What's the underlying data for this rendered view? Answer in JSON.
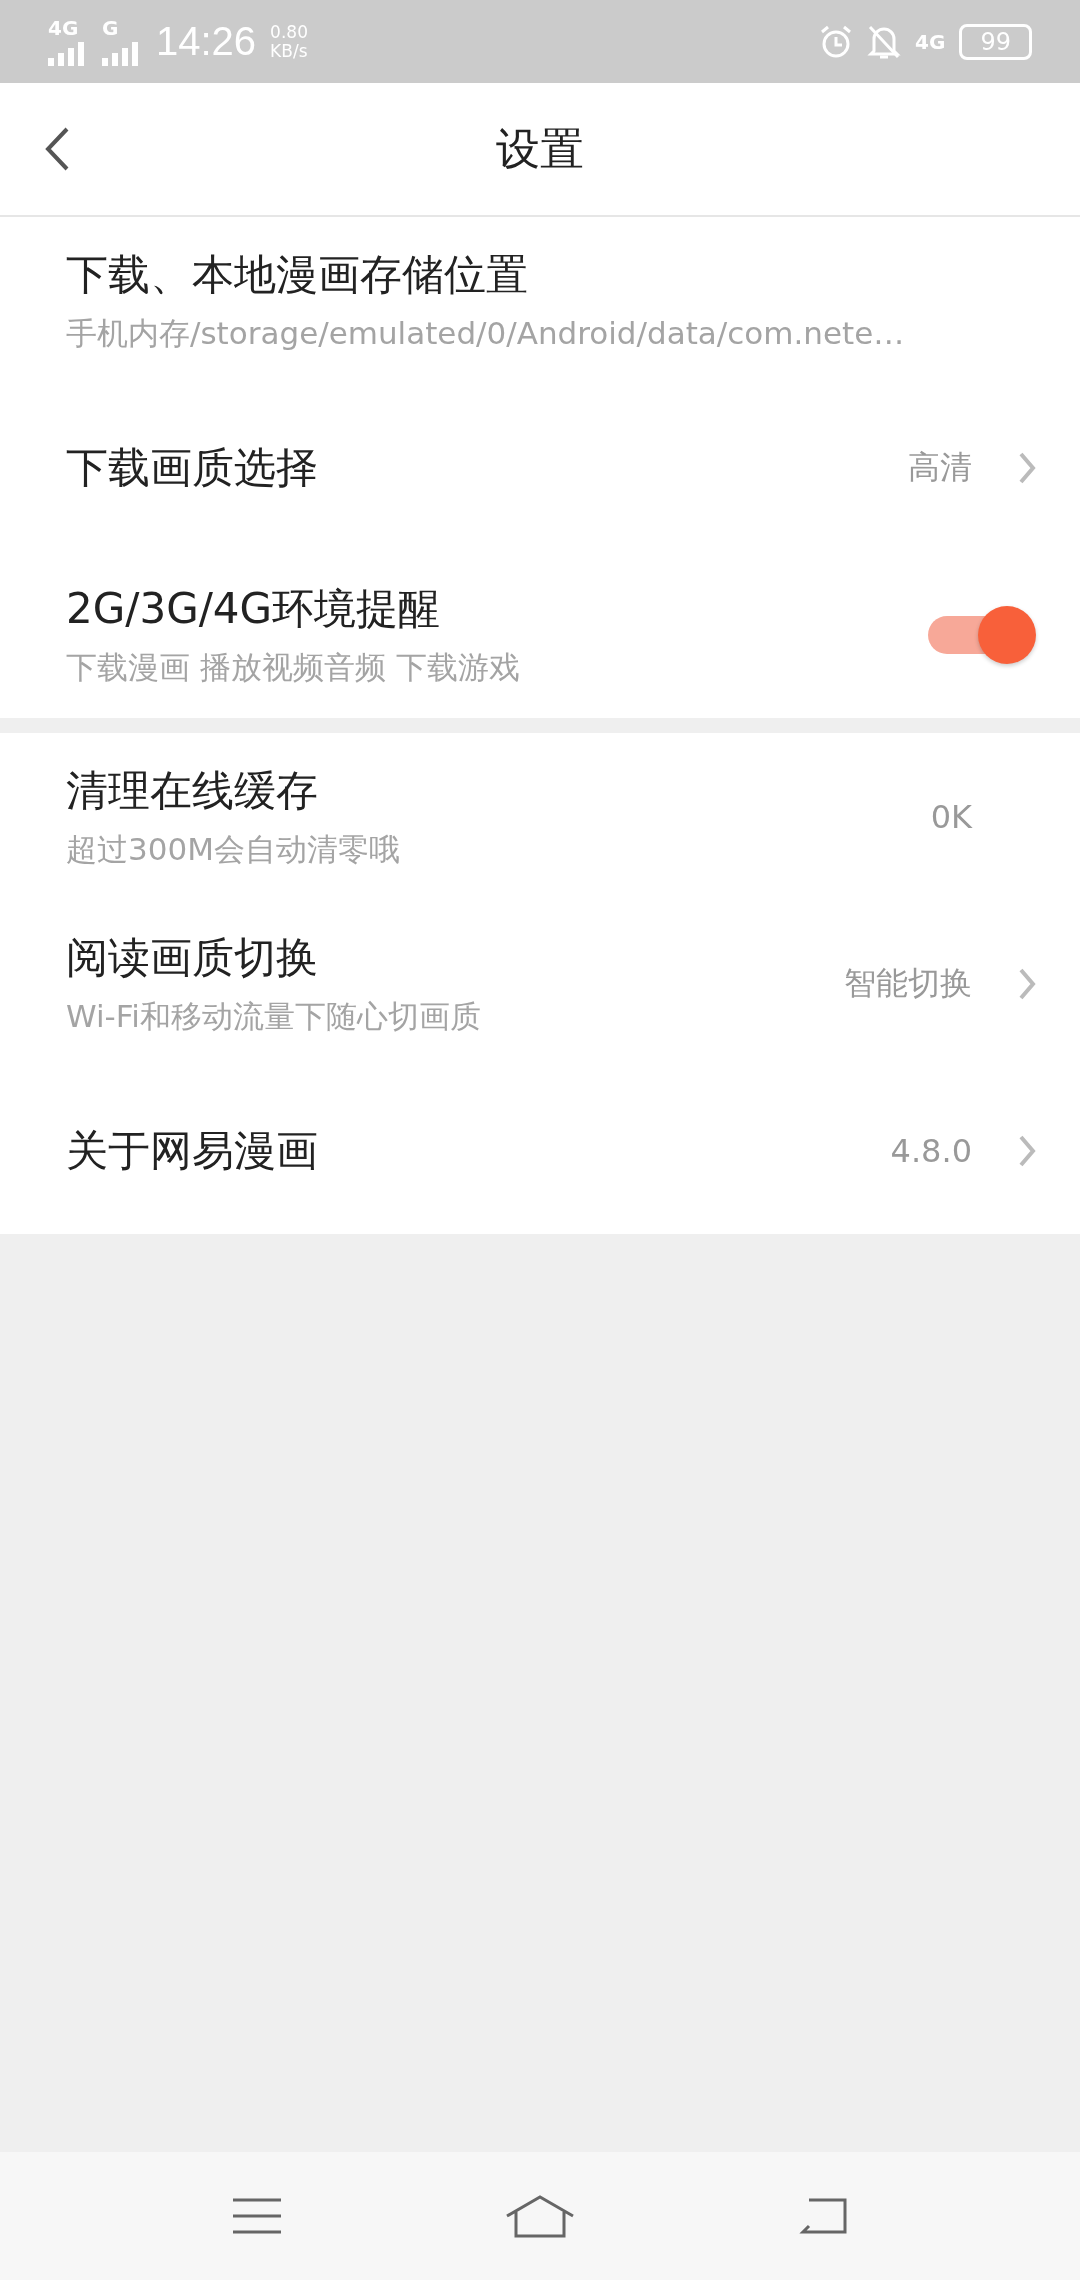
{
  "status_bar": {
    "network_1": "4G",
    "network_2": "G",
    "time": "14:26",
    "speed_value": "0.80",
    "speed_unit": "KB/s",
    "network_3": "4G",
    "battery": "99"
  },
  "header": {
    "title": "设置"
  },
  "sections": [
    {
      "rows": [
        {
          "kind": "value",
          "title": "下载、本地漫画存储位置",
          "subtitle": "手机内存/storage/emulated/0/Android/data/com.nete…",
          "has_arrow": false
        },
        {
          "kind": "value",
          "title": "下载画质选择",
          "value": "高清",
          "has_arrow": true
        },
        {
          "kind": "toggle",
          "title": "2G/3G/4G环境提醒",
          "subtitle": "下载漫画 播放视频音频 下载游戏",
          "on": true
        }
      ]
    },
    {
      "rows": [
        {
          "kind": "value",
          "title": "清理在线缓存",
          "subtitle": "超过300M会自动清零哦",
          "value": "0K",
          "has_arrow": false
        },
        {
          "kind": "value",
          "title": "阅读画质切换",
          "subtitle": "Wi-Fi和移动流量下随心切画质",
          "value": "智能切换",
          "has_arrow": true
        },
        {
          "kind": "value",
          "title": "关于网易漫画",
          "value": "4.8.0",
          "has_arrow": true
        }
      ]
    }
  ]
}
